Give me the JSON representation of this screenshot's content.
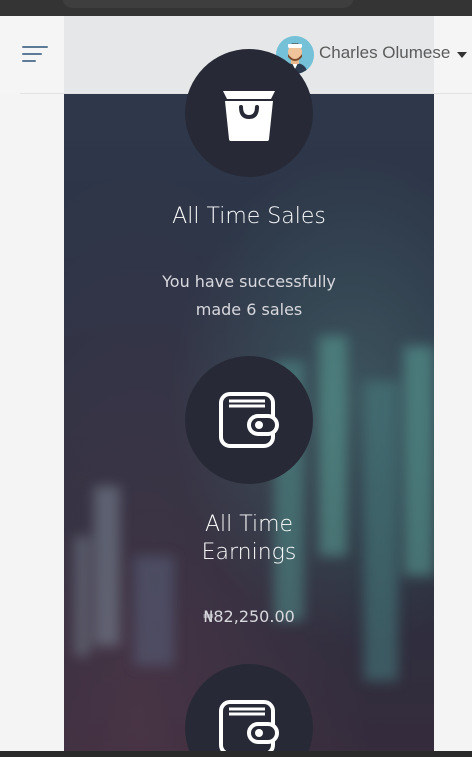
{
  "header": {
    "user_name": "Charles Olumese",
    "menu_icon": "hamburger-menu-icon",
    "dropdown_icon": "caret-down-icon"
  },
  "cards": [
    {
      "icon": "shopping-bag-icon",
      "title": "All Time Sales",
      "description_line1": "You have successfully",
      "description_line2": "made 6 sales"
    },
    {
      "icon": "wallet-icon",
      "title_line1": "All Time",
      "title_line2": "Earnings",
      "value": "₦82,250.00"
    },
    {
      "icon": "wallet-icon"
    }
  ],
  "colors": {
    "panel_dark": "#2c3446",
    "circle": "#272a36",
    "header_bg": "#f4f4f4",
    "menu_icon": "#5d7a96"
  }
}
